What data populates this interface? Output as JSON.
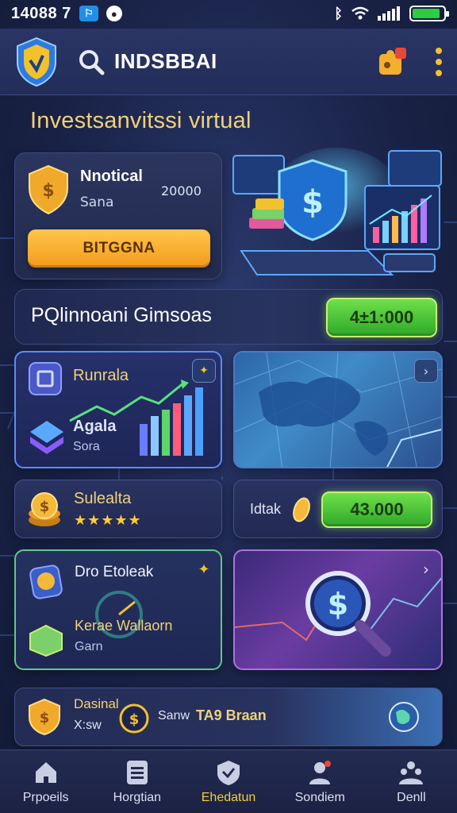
{
  "status_bar": {
    "time": "14088 7",
    "battery_level": 0.9
  },
  "header": {
    "title": "INDSBBAI"
  },
  "hero": {
    "title": "Investsanvitssi virtual",
    "card_title": "Nnotical",
    "card_subtitle": "Sana",
    "card_value": "20000",
    "cta_label": "BITGGNA"
  },
  "portfolio": {
    "label": "PQlinnoani Gimsoas",
    "amount": "4±1:000"
  },
  "cards": {
    "analytics": {
      "title": "Runrala",
      "subtitle": "Agala",
      "caption": "Sora"
    },
    "rating": {
      "title": "Sulealta",
      "stars": "★★★★★"
    },
    "balance": {
      "label": "Idtak",
      "amount": "43.000"
    },
    "explore": {
      "title": "Dro Etoleak",
      "subtitle": "Kerae Wallaorn",
      "caption": "Garn"
    },
    "footer": {
      "title": "Dasinal",
      "subtitle": "X:sw",
      "label_a": "Sanw",
      "label_b": "TA9 Braan"
    }
  },
  "bottom_nav": [
    {
      "label": "Prpoeils",
      "icon": "home-icon"
    },
    {
      "label": "Horgtian",
      "icon": "list-icon"
    },
    {
      "label": "Ehedatun",
      "icon": "shield-check-icon",
      "active": true
    },
    {
      "label": "Sondiem",
      "icon": "profile-icon"
    },
    {
      "label": "Denll",
      "icon": "community-icon"
    }
  ],
  "colors": {
    "accent_gold": "#f4cd3c",
    "accent_orange": "#f39a1c",
    "accent_green": "#2fa82a",
    "background": "#1a2348"
  }
}
